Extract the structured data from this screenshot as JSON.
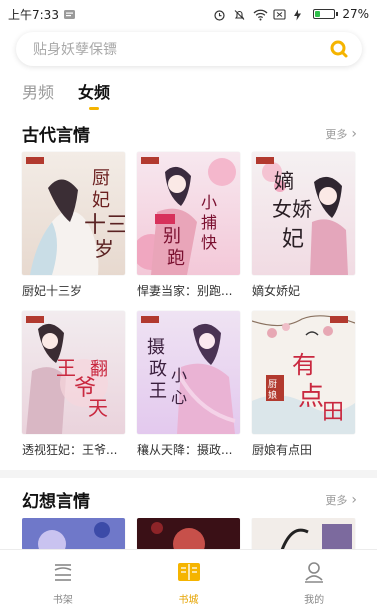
{
  "status_bar": {
    "time": "上午7:33",
    "battery_percent": "27%",
    "battery_level": 0.27,
    "icons": [
      "notification-icon",
      "alarm-icon",
      "silent-icon",
      "wifi-icon",
      "sim-icon",
      "charging-icon",
      "battery-icon"
    ]
  },
  "search": {
    "placeholder": "贴身妖孽保镖",
    "icon": "search-icon",
    "accent": "#f5b400"
  },
  "tabs": [
    {
      "label": "男频",
      "active": false
    },
    {
      "label": "女频",
      "active": true
    }
  ],
  "sections": [
    {
      "title": "古代言情",
      "more_label": "更多",
      "books": [
        {
          "title": "厨妃十三岁"
        },
        {
          "title": "悍妻当家：别跑..."
        },
        {
          "title": "嫡女娇妃"
        },
        {
          "title": "透视狂妃：王爷..."
        },
        {
          "title": "穰从天降：摄政..."
        },
        {
          "title": "厨娘有点田"
        }
      ]
    },
    {
      "title": "幻想言情",
      "more_label": "更多"
    }
  ],
  "bottom_nav": [
    {
      "label": "书架",
      "icon": "bookshelf-icon",
      "active": false
    },
    {
      "label": "书城",
      "icon": "bookstore-icon",
      "active": true
    },
    {
      "label": "我的",
      "icon": "profile-icon",
      "active": false
    }
  ],
  "colors": {
    "accent": "#f5b400",
    "text_primary": "#111111",
    "text_secondary": "#9a9a9a"
  }
}
